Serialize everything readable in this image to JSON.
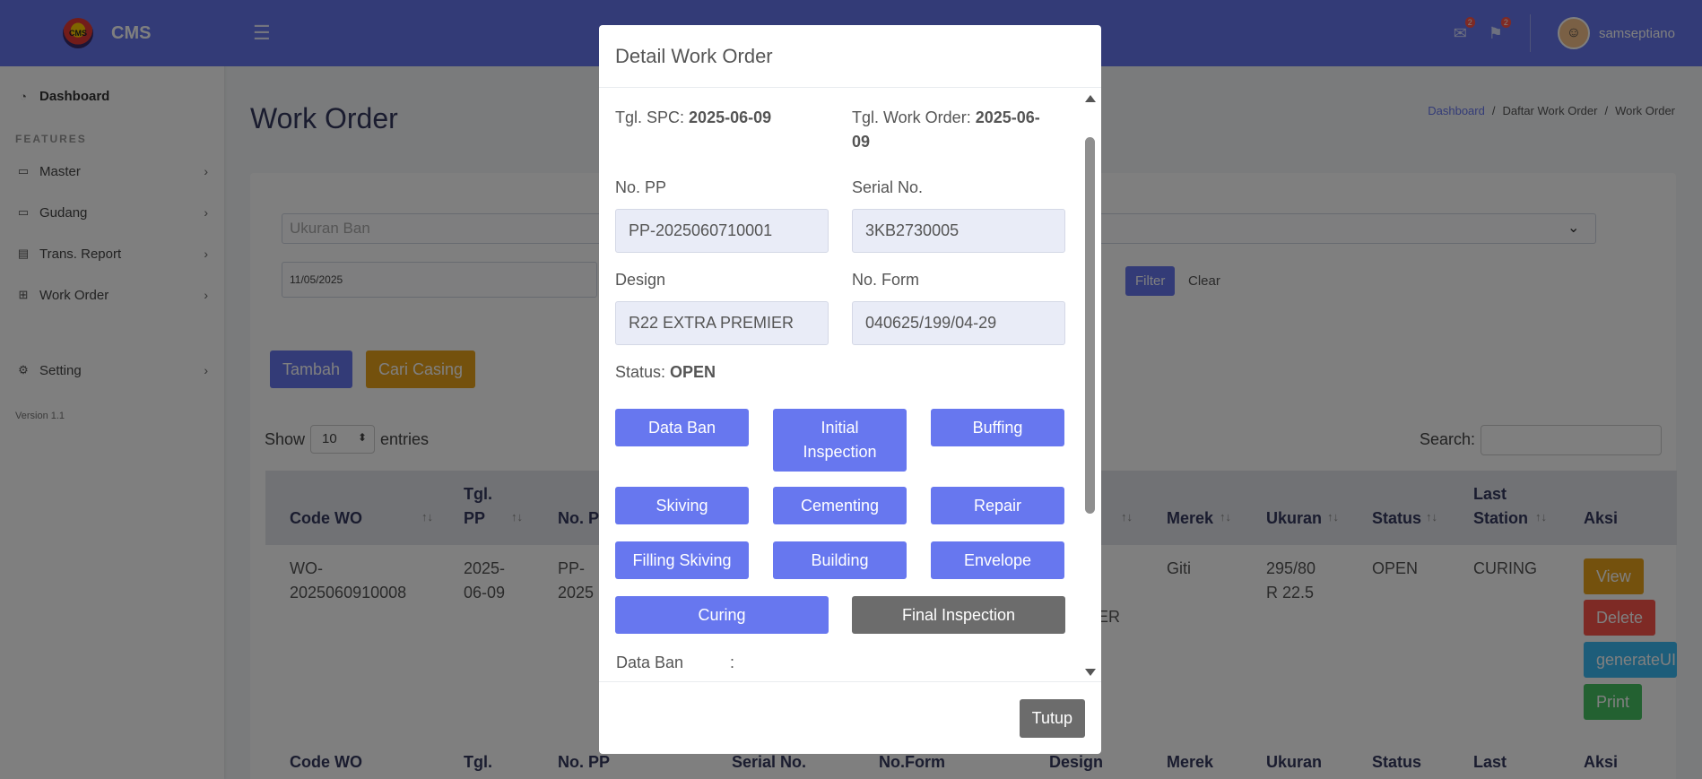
{
  "brand": {
    "logo_text": "CMS",
    "name": "CMS"
  },
  "sidebar": {
    "dashboard": "Dashboard",
    "features_header": "FEATURES",
    "items": [
      {
        "label": "Master"
      },
      {
        "label": "Gudang"
      },
      {
        "label": "Trans. Report"
      },
      {
        "label": "Work Order"
      }
    ],
    "setting": "Setting",
    "version": "Version 1.1"
  },
  "navbar": {
    "mail_badge": "2",
    "notif_badge": "2",
    "username": "samseptiano"
  },
  "page": {
    "title": "Work Order"
  },
  "breadcrumb": {
    "home": "Dashboard",
    "list": "Daftar Work Order",
    "current": "Work Order"
  },
  "filters": {
    "size_placeholder": "Ukuran Ban",
    "date_value": "11/05/2025",
    "filter_btn": "Filter",
    "clear_btn": "Clear"
  },
  "actions": {
    "add": "Tambah",
    "find_casing": "Cari Casing"
  },
  "table": {
    "show": "Show",
    "entries_value": "10",
    "entries": "entries",
    "search_label": "Search:",
    "headers": {
      "code_wo": "Code WO",
      "tgl_pp_1": "Tgl.",
      "tgl_pp_2": "PP",
      "no_pp": "No. PP",
      "merek": "Merek",
      "ukuran": "Ukuran",
      "status": "Status",
      "last_1": "Last",
      "last_2": "Station",
      "aksi": "Aksi"
    },
    "footer_headers": {
      "code_wo": "Code WO",
      "tgl": "Tgl.",
      "no_pp": "No. PP",
      "serial": "Serial No.",
      "form": "No.Form",
      "design": "Design",
      "merek": "Merek",
      "ukuran": "Ukuran",
      "status": "Status",
      "last": "Last",
      "aksi": "Aksi"
    },
    "row": {
      "code_1": "WO-",
      "code_2": "2025060910008",
      "tgl_1": "2025-",
      "tgl_2": "06-09",
      "pp_1": "PP-",
      "pp_2": "2025",
      "design_frag": "ER",
      "merek": "Giti",
      "ukuran_1": "295/80",
      "ukuran_2": "R 22.5",
      "status": "OPEN",
      "last": "CURING",
      "btn_view": "View",
      "btn_delete": "Delete",
      "btn_generate": "generateUI",
      "btn_print": "Print"
    }
  },
  "modal": {
    "title": "Detail Work Order",
    "tgl_spc_label": "Tgl. SPC:",
    "tgl_spc_value": "2025-06-09",
    "tgl_wo_label": "Tgl. Work Order:",
    "tgl_wo_value_1": "2025-06-",
    "tgl_wo_value_2": "09",
    "no_pp_label": "No. PP",
    "no_pp_value": "PP-2025060710001",
    "serial_label": "Serial No.",
    "serial_value": "3KB2730005",
    "design_label": "Design",
    "design_value": "R22 EXTRA PREMIER",
    "form_label": "No. Form",
    "form_value": "040625/199/04-29",
    "status_label": "Status:",
    "status_value": "OPEN",
    "stations": {
      "data_ban": "Data Ban",
      "initial_1": "Initial",
      "initial_2": "Inspection",
      "buffing": "Buffing",
      "skiving": "Skiving",
      "cementing": "Cementing",
      "repair": "Repair",
      "filling": "Filling Skiving",
      "building": "Building",
      "envelope": "Envelope",
      "curing": "Curing",
      "final": "Final Inspection"
    },
    "section_label": "Data Ban",
    "section_colon": ":",
    "close_btn": "Tutup"
  },
  "colors": {
    "primary": "#6777ef",
    "warning": "#e8a21a",
    "danger": "#fc544b",
    "info": "#3abaf4",
    "success": "#47c363",
    "secondary": "#6c6c6c"
  }
}
